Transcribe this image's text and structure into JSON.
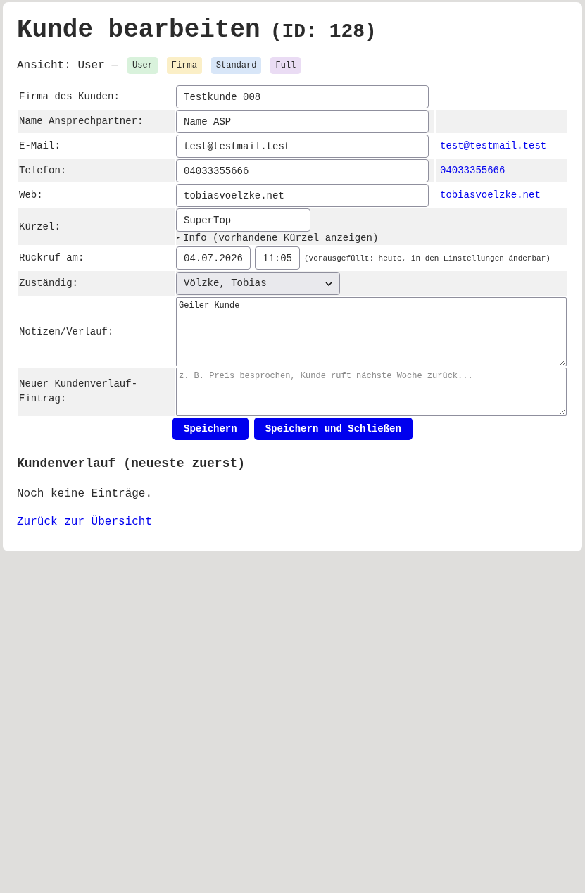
{
  "title": "Kunde bearbeiten",
  "title_id": "(ID: 128)",
  "view": {
    "label": "Ansicht: User —",
    "badges": [
      {
        "label": "User",
        "color": "#d9f2dc"
      },
      {
        "label": "Firma",
        "color": "#fbefc7"
      },
      {
        "label": "Standard",
        "color": "#d8e6f8"
      },
      {
        "label": "Full",
        "color": "#eadcf4"
      }
    ]
  },
  "form_rows": [
    {
      "kind": "text",
      "label": "Firma des Kunden:",
      "value": "Testkunde 008"
    },
    {
      "kind": "text",
      "label": "Name Ansprechpartner:",
      "value": "Name ASP"
    },
    {
      "kind": "text",
      "label": "E-Mail:",
      "value": "test@testmail.test",
      "link": "test@testmail.test"
    },
    {
      "kind": "text",
      "label": "Telefon:",
      "value": "04033355666",
      "link": "04033355666"
    },
    {
      "kind": "text",
      "label": "Web:",
      "value": "tobiasvoelzke.net",
      "link": "tobiasvoelzke.net"
    },
    {
      "kind": "short",
      "label": "Kürzel:",
      "value": "SuperTop",
      "disclosure": "▸",
      "details": "Info (vorhandene Kürzel anzeigen)"
    },
    {
      "kind": "datetime",
      "label": "Rückruf am:",
      "date": "04.07.2026",
      "time": "11:05",
      "hint": "(Vorausgefüllt: heute, in den Einstellungen änderbar)"
    },
    {
      "kind": "select",
      "label": "Zuständig:",
      "value": "Völzke, Tobias"
    },
    {
      "kind": "textarea",
      "label": "Notizen/Verlauf:",
      "value": "Geiler Kunde"
    },
    {
      "kind": "textarea_small",
      "label": "Neuer Kundenverlauf-Eintrag:",
      "placeholder": "z. B. Preis besprochen, Kunde ruft nächste Woche zurück..."
    }
  ],
  "buttons": [
    "Speichern",
    "Speichern und Schließen"
  ],
  "history": {
    "heading": "Kundenverlauf (neueste zuerst)",
    "empty": "Noch keine Einträge."
  },
  "back_link": "Zurück zur Übersicht"
}
